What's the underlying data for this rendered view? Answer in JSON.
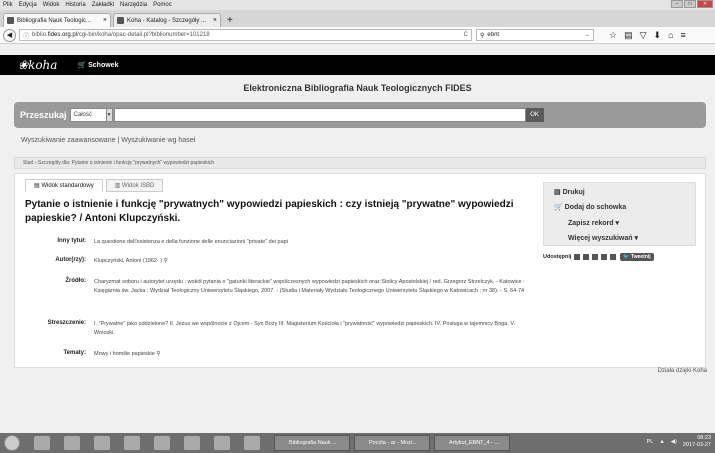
{
  "menubar": [
    "Plik",
    "Edycja",
    "Widok",
    "Historia",
    "Zakładki",
    "Narzędzia",
    "Pomoc"
  ],
  "tabs": [
    {
      "label": "Bibliografia Nauk Teologic...",
      "active": true
    },
    {
      "label": "Koha - Katalog - Szczegóły ...",
      "active": false
    }
  ],
  "nav": {
    "url_prefix": "biblio.",
    "url_host": "fides.org.pl",
    "url_path": "/cgi-bin/koha/opac-detail.pl?biblionumber=101218",
    "search_value": "ebnt"
  },
  "koha": {
    "logo": "koha",
    "cart": "Schowek"
  },
  "banner": "Elektroniczna Bibliografia Nauk Teologicznych FIDES",
  "search": {
    "label": "Przeszukaj",
    "scope": "Całość",
    "ok": "OK"
  },
  "links": {
    "advanced": "Wyszukiwanie zaawansowane",
    "sep": "|",
    "headings": "Wyszukiwanie wg haseł"
  },
  "breadcrumb": "Start › Szczegóły dla: Pytanie o istnienie i funkcję \"prywatnych\" wypowiedzi papieskich",
  "view_tabs": {
    "standard": "Widok standardowy",
    "isbd": "Widok ISBD"
  },
  "record": {
    "title": "Pytanie o istnienie i funkcję \"prywatnych\" wypowiedzi papieskich : czy istnieją \"prywatne\" wypowiedzi papieskie? / Antoni Klupczyński.",
    "fields": [
      {
        "label": "Inny tytuł:",
        "value": "La questione dell'esistenza e della funzione delle enunciazioni \"private\" dei papi"
      },
      {
        "label": "Autor(rzy):",
        "value": "Klupczyński, Antoni (1962- )"
      },
      {
        "label": "Źródło:",
        "value": "Charyzmat soboru i autorytet urzędu : wokół pytania o \"gatunki literackie\" współczesnych wypowiedzi papieskich oraz Stolicy Apostolskiej / red. Grzegorz Strzelczyk. - Katowice : Księgarnia św. Jacka ; Wydział Teologiczny Uniwersytetu Śląskiego, 2007. - (Studia i Materiały Wydziału Teologicznego Uniwersytetu Śląskiego w Katowicach ; nr 38). - S. 64-74"
      },
      {
        "label": "Streszczenie:",
        "value": "I. \"Prywatne\" jako oddzielone? II. Jezus we wspólnocie z Ojcem - Syn Boży III. Magisterium Kościoła i \"prywatność\" wypowiedzi papieskich. IV. Posługa w tajemnicy Boga. V. Wnioski."
      },
      {
        "label": "Tematy:",
        "value": "Mowy i homilie papieskie"
      }
    ]
  },
  "sidebar": {
    "print": "Drukuj",
    "add_cart": "Dodaj do schowka",
    "save": "Zapisz rekord ▾",
    "more_search": "Więcej wyszukiwań ▾",
    "share": "Udostępnij",
    "tweet": "Tweetnij"
  },
  "footer": "Działa dzięki Koha",
  "taskbar": {
    "tasks": [
      "Bibliografia Nauk ...",
      "Poczta - ar - Mozi...",
      "Artykuł_EBNT_4 - ..."
    ],
    "lang": "PL",
    "time": "08:23",
    "date": "2017-03-27"
  }
}
